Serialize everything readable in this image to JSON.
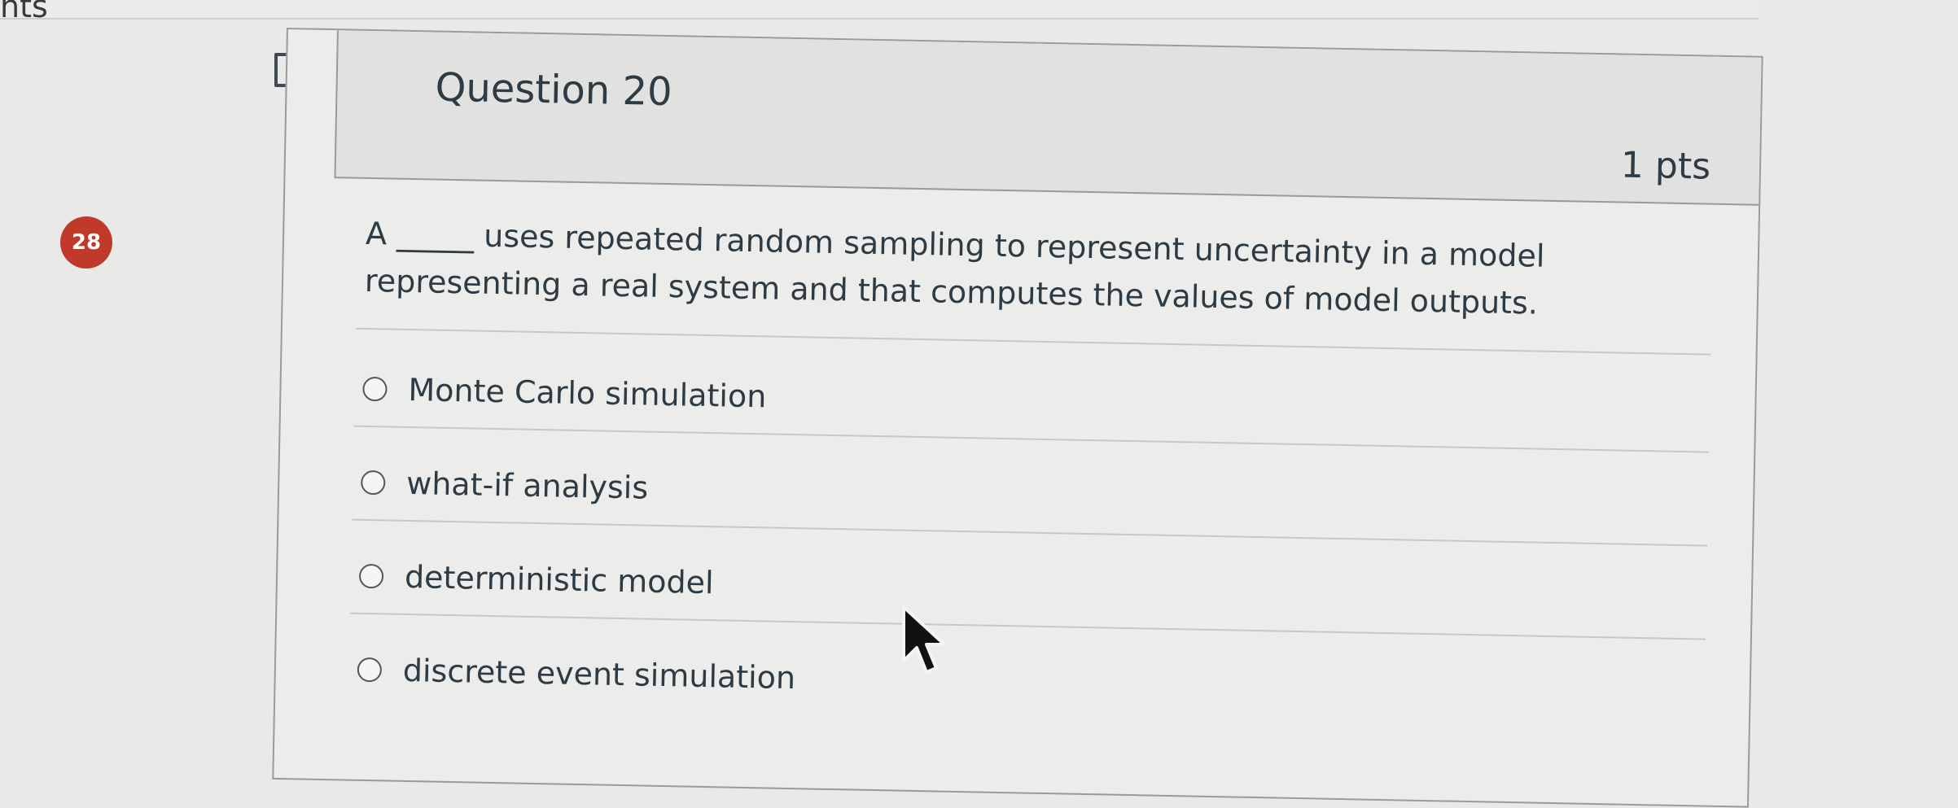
{
  "corner_text": "nts",
  "badge": {
    "count": "28",
    "color": "#c0392b"
  },
  "question": {
    "title": "Question 20",
    "points": "1 pts",
    "text": "A _____ uses repeated random sampling to represent uncertainty in a model representing a real system and that computes the values of model outputs."
  },
  "answers": [
    {
      "label": "Monte Carlo simulation",
      "selected": false
    },
    {
      "label": "what-if analysis",
      "selected": false
    },
    {
      "label": "deterministic model",
      "selected": false
    },
    {
      "label": "discrete event simulation",
      "selected": false
    }
  ],
  "icons": {
    "flag": "flag-icon",
    "cursor": "mouse-pointer-icon"
  }
}
